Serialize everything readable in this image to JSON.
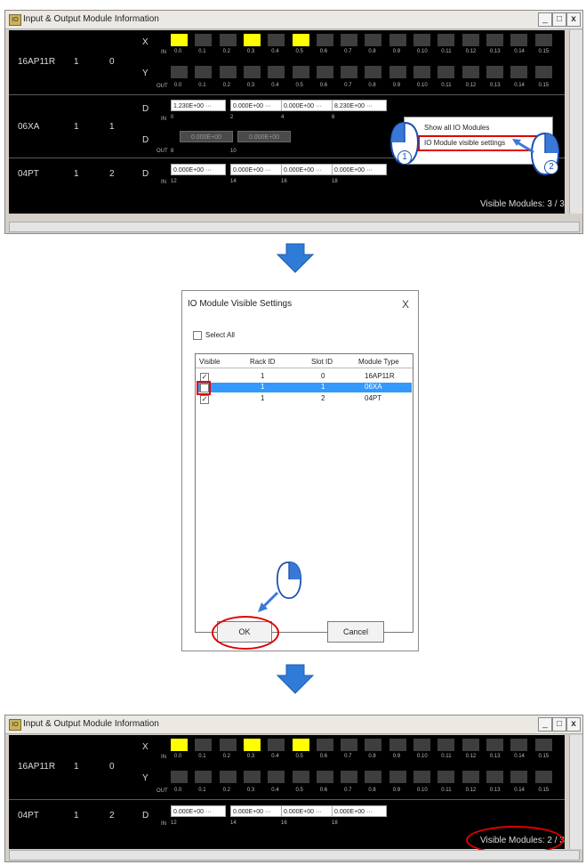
{
  "top_window": {
    "title": "Input & Output Module Information",
    "modules": [
      {
        "name": "16AP11R",
        "rack": "1",
        "slot": "0"
      },
      {
        "name": "06XA",
        "rack": "1",
        "slot": "1"
      },
      {
        "name": "04PT",
        "rack": "1",
        "slot": "2"
      }
    ],
    "x_tag": "X",
    "y_tag": "Y",
    "d_tag": "D",
    "in_tag": "IN",
    "out_tag": "OUT",
    "x_labels": [
      "0.0",
      "0.1",
      "0.2",
      "0.3",
      "0.4",
      "0.5",
      "0.6",
      "0.7",
      "0.8",
      "0.9",
      "0.10",
      "0.11",
      "0.12",
      "0.13",
      "0.14",
      "0.15"
    ],
    "y_labels": [
      "0.0",
      "0.1",
      "0.2",
      "0.3",
      "0.4",
      "0.5",
      "0.6",
      "0.7",
      "0.8",
      "0.9",
      "0.10",
      "0.11",
      "0.12",
      "0.13",
      "0.14",
      "0.15"
    ],
    "x_on": [
      true,
      false,
      false,
      true,
      false,
      true,
      false,
      false,
      false,
      false,
      false,
      false,
      false,
      false,
      false,
      false
    ],
    "d06_in_values": [
      "1.230E+00 ···",
      "0.000E+00 ···",
      "0.000E+00 ···",
      "8.230E+00 ···"
    ],
    "d06_in_addr": [
      "0",
      "2",
      "4",
      "6"
    ],
    "d06_out_values": [
      "0.000E+00",
      "0.000E+00"
    ],
    "d06_out_addr": [
      "8",
      "10"
    ],
    "d04_values": [
      "0.000E+00 ···",
      "0.000E+00 ···",
      "0.000E+00 ···",
      "0.000E+00 ···"
    ],
    "d04_addr": [
      "12",
      "14",
      "16",
      "18"
    ],
    "visible_modules": "Visible Modules: 3 / 3",
    "context_menu": [
      "Show all IO Modules",
      "IO Module visible settings"
    ],
    "step1": "1",
    "step2": "2"
  },
  "dialog": {
    "title": "IO Module Visible Settings",
    "close": "X",
    "select_all": "Select All",
    "columns": [
      "Visible",
      "Rack ID",
      "Slot ID",
      "Module Type"
    ],
    "rows": [
      {
        "visible": true,
        "rack": "1",
        "slot": "0",
        "type": "16AP11R"
      },
      {
        "visible": false,
        "rack": "1",
        "slot": "1",
        "type": "06XA"
      },
      {
        "visible": true,
        "rack": "1",
        "slot": "2",
        "type": "04PT"
      }
    ],
    "ok": "OK",
    "cancel": "Cancel"
  },
  "bottom_window": {
    "title": "Input & Output Module Information",
    "modules": [
      {
        "name": "16AP11R",
        "rack": "1",
        "slot": "0"
      },
      {
        "name": "04PT",
        "rack": "1",
        "slot": "2"
      }
    ],
    "visible_modules": "Visible Modules: 2 / 3"
  },
  "colors": {
    "highlight_red": "#e00000",
    "selection_blue": "#3399ff",
    "led_on": "#ffff00",
    "arrow_blue": "#3a78d8"
  }
}
